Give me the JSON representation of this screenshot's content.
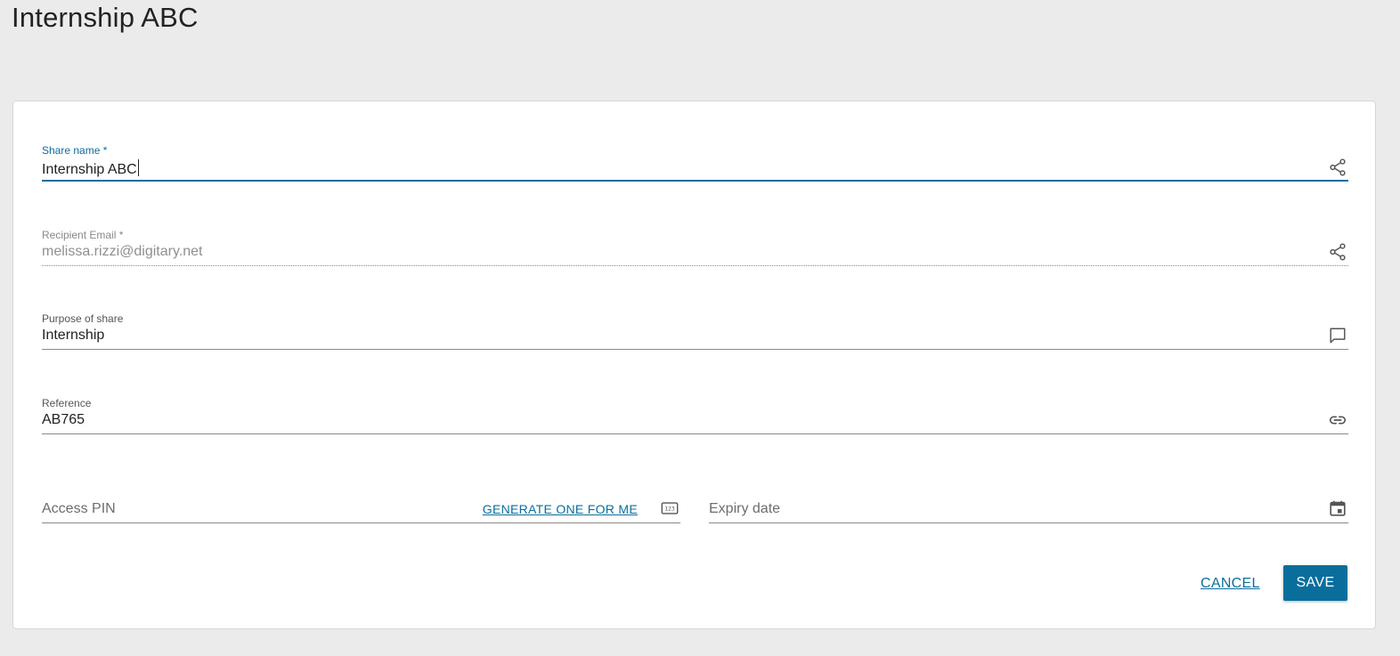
{
  "page": {
    "title": "Internship ABC"
  },
  "form": {
    "share_name": {
      "label": "Share name *",
      "value": "Internship ABC",
      "icon": "share-icon"
    },
    "recipient_email": {
      "label": "Recipient Email *",
      "value": "melissa.rizzi@digitary.net",
      "icon": "share-icon"
    },
    "purpose": {
      "label": "Purpose of share",
      "value": "Internship",
      "icon": "comment-icon"
    },
    "reference": {
      "label": "Reference",
      "value": "AB765",
      "icon": "link-icon"
    },
    "access_pin": {
      "placeholder": "Access PIN",
      "generate_label": "GENERATE ONE FOR ME",
      "icon": "numeric-keypad-icon"
    },
    "expiry_date": {
      "placeholder": "Expiry date",
      "icon": "calendar-icon"
    }
  },
  "actions": {
    "cancel_label": "CANCEL",
    "save_label": "SAVE"
  },
  "colors": {
    "accent": "#0a6e9c",
    "background": "#ebebeb",
    "card": "#ffffff"
  }
}
